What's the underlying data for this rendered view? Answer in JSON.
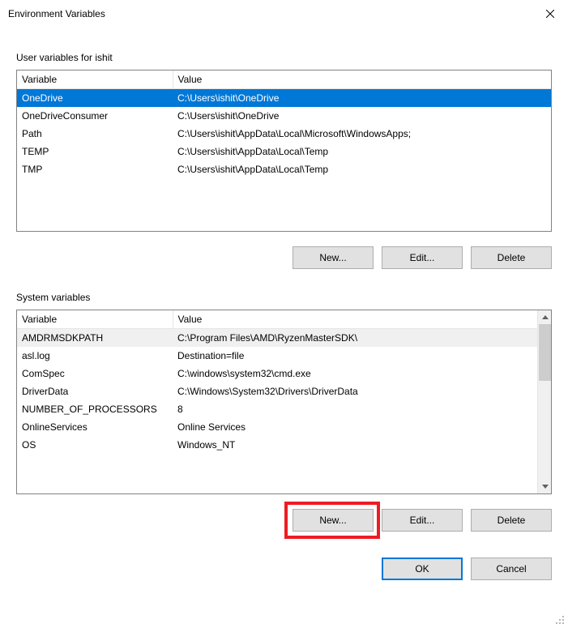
{
  "window": {
    "title": "Environment Variables"
  },
  "user_section": {
    "label": "User variables for ishit",
    "columns": {
      "variable": "Variable",
      "value": "Value"
    },
    "rows": [
      {
        "variable": "OneDrive",
        "value": "C:\\Users\\ishit\\OneDrive",
        "selected": true
      },
      {
        "variable": "OneDriveConsumer",
        "value": "C:\\Users\\ishit\\OneDrive"
      },
      {
        "variable": "Path",
        "value": "C:\\Users\\ishit\\AppData\\Local\\Microsoft\\WindowsApps;"
      },
      {
        "variable": "TEMP",
        "value": "C:\\Users\\ishit\\AppData\\Local\\Temp"
      },
      {
        "variable": "TMP",
        "value": "C:\\Users\\ishit\\AppData\\Local\\Temp"
      }
    ],
    "buttons": {
      "new": "New...",
      "edit": "Edit...",
      "delete": "Delete"
    }
  },
  "system_section": {
    "label": "System variables",
    "columns": {
      "variable": "Variable",
      "value": "Value"
    },
    "rows": [
      {
        "variable": "AMDRMSDKPATH",
        "value": "C:\\Program Files\\AMD\\RyzenMasterSDK\\",
        "alt_selected": true
      },
      {
        "variable": "asl.log",
        "value": "Destination=file"
      },
      {
        "variable": "ComSpec",
        "value": "C:\\windows\\system32\\cmd.exe"
      },
      {
        "variable": "DriverData",
        "value": "C:\\Windows\\System32\\Drivers\\DriverData"
      },
      {
        "variable": "NUMBER_OF_PROCESSORS",
        "value": "8"
      },
      {
        "variable": "OnlineServices",
        "value": "Online Services"
      },
      {
        "variable": "OS",
        "value": "Windows_NT"
      }
    ],
    "buttons": {
      "new": "New...",
      "edit": "Edit...",
      "delete": "Delete"
    }
  },
  "dialog_buttons": {
    "ok": "OK",
    "cancel": "Cancel"
  }
}
